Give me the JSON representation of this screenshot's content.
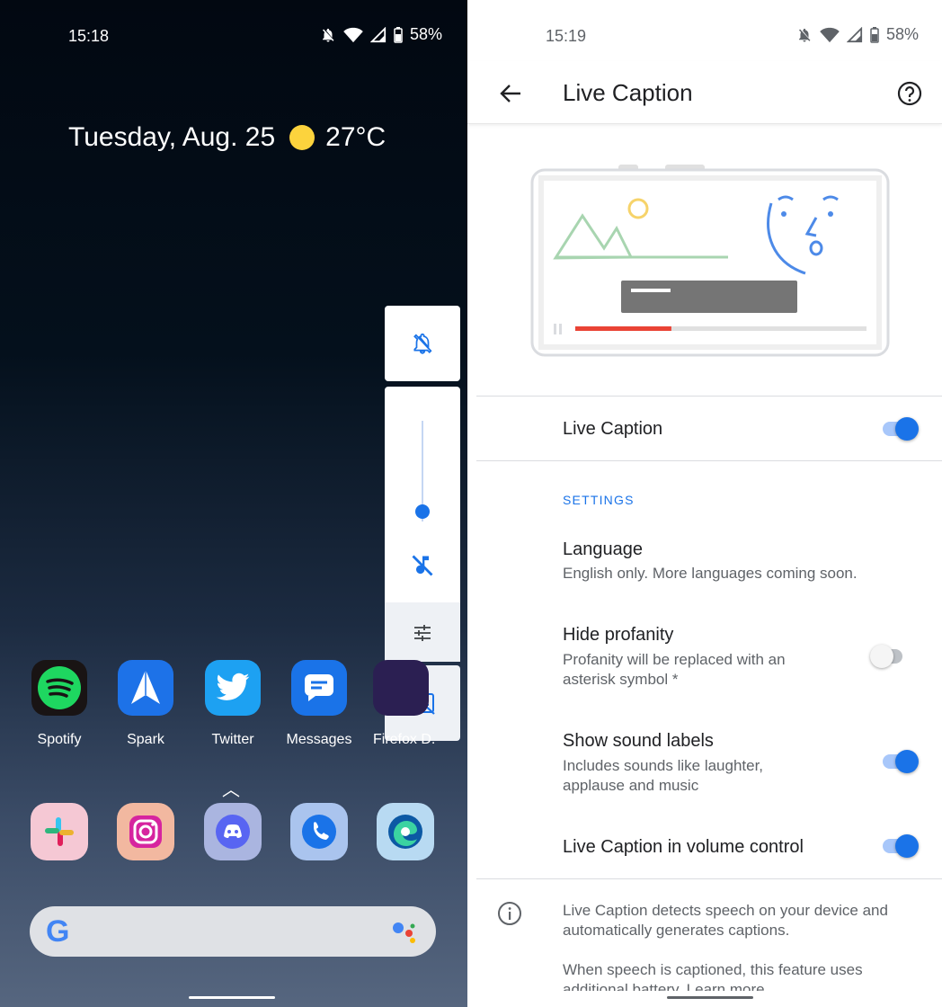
{
  "left_phone": {
    "status_time": "15:18",
    "battery": "58%",
    "date": "Tuesday, Aug. 25",
    "temperature": "27°C",
    "apps": [
      {
        "label": "Spotify",
        "icon": "spotify-icon"
      },
      {
        "label": "Spark",
        "icon": "spark-icon"
      },
      {
        "label": "Twitter",
        "icon": "twitter-icon"
      },
      {
        "label": "Messages",
        "icon": "messages-icon"
      },
      {
        "label": "Firefox D...",
        "icon": "firefox-icon"
      }
    ],
    "dock": [
      "slack-icon",
      "instagram-icon",
      "discord-icon",
      "phone-icon",
      "edge-icon"
    ],
    "volume_level": 0.1,
    "colors": {
      "accent": "#1a73e8",
      "sun": "#fcd33d"
    }
  },
  "right_phone": {
    "status_time": "15:19",
    "battery": "58%",
    "title": "Live Caption",
    "main_toggle": {
      "label": "Live Caption",
      "on": true
    },
    "section_header": "SETTINGS",
    "language": {
      "title": "Language",
      "subtitle": "English only. More languages coming soon."
    },
    "hide_profanity": {
      "title": "Hide profanity",
      "subtitle_1": "Profanity will be replaced with an",
      "subtitle_2": "asterisk symbol *",
      "on": false
    },
    "sound_labels": {
      "title": "Show sound labels",
      "subtitle_1": "Includes sounds like laughter,",
      "subtitle_2": "applause and music",
      "on": true
    },
    "volume_control": {
      "title": "Live Caption in volume control",
      "on": true
    },
    "info_1": "Live Caption detects speech on your device and",
    "info_2": "automatically generates captions.",
    "info_3": "When speech is captioned, this feature uses",
    "info_4_partial": "additional battery. Learn more",
    "video_progress": 0.33,
    "colors": {
      "accent": "#1a73e8",
      "progress": "#ea4335"
    }
  }
}
